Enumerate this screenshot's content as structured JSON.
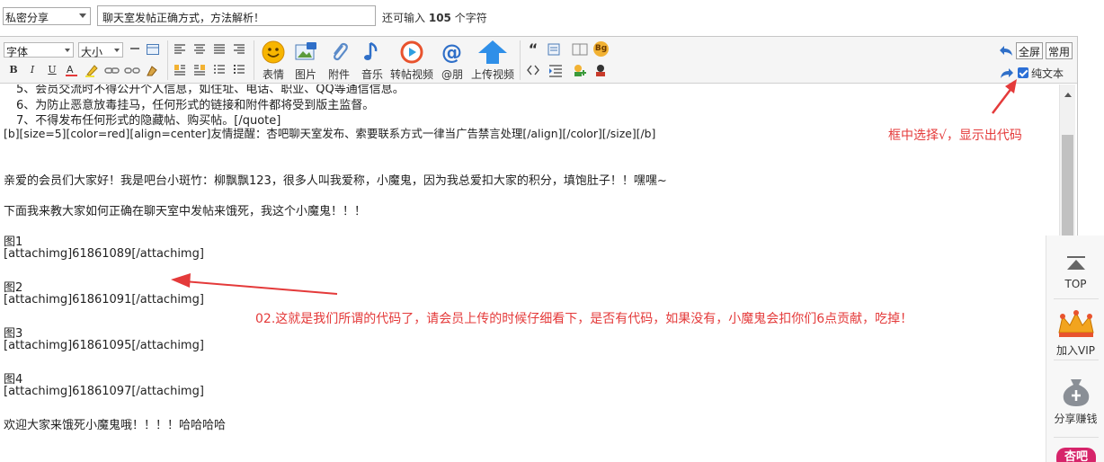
{
  "topbar": {
    "category": "私密分享",
    "title_value": "聊天室发帖正确方式，方法解析！",
    "remaining_prefix": "还可输入",
    "remaining_count": "105",
    "remaining_suffix": "个字符"
  },
  "toolbar": {
    "font_select": "字体",
    "size_select": "大小",
    "big_buttons": [
      "表情",
      "图片",
      "附件",
      "音乐",
      "转帖视频",
      "@朋",
      "上传视频"
    ],
    "fullscreen": "全屏",
    "common": "常用",
    "plain_text": "纯文本",
    "bg_badge": "Bg",
    "bold": "B",
    "italic": "I",
    "underline": "U",
    "quote_glyph": "“"
  },
  "content": {
    "lines": [
      "5、会员交流时不得公开个人信息，如住址、电话、职业、QQ等通信信息。",
      "6、为防止恶意放毒挂马，任何形式的链接和附件都将受到版主监督。",
      "7、不得发布任何形式的隐藏帖、购买帖。[/quote]",
      "[b][size=5][color=red][align=center]友情提醒：杏吧聊天室发布、索要联系方式一律当广告禁言处理[/align][/color][/size][/b]",
      "亲爱的会员们大家好！我是吧台小斑竹：柳飘飘123，很多人叫我爱称，小魔鬼，因为我总爱扣大家的积分，填饱肚子！！嘿嘿~",
      "下面我来教大家如何正确在聊天室中发帖来饿死，我这个小魔鬼！！！",
      "图1",
      "[attachimg]61861089[/attachimg]",
      "图2",
      "[attachimg]61861091[/attachimg]",
      "图3",
      "[attachimg]61861095[/attachimg]",
      "图4",
      "[attachimg]61861097[/attachimg]",
      "欢迎大家来饿死小魔鬼哦！！！！哈哈哈哈"
    ]
  },
  "annotations": {
    "checkbox_note": "框中选择√，显示出代码",
    "code_note": "02.这就是我们所谓的代码了，请会员上传的时候仔细看下，是否有代码，如果没有，小魔鬼会扣你们6点贡献，吃掉！"
  },
  "float_panel": {
    "top": "TOP",
    "vip": "加入VIP",
    "share": "分享赚钱",
    "brand": "杏吧"
  },
  "colors": {
    "annotation": "#e43a3a",
    "accent_blue": "#2b6fd6",
    "brand": "#d6246a"
  }
}
